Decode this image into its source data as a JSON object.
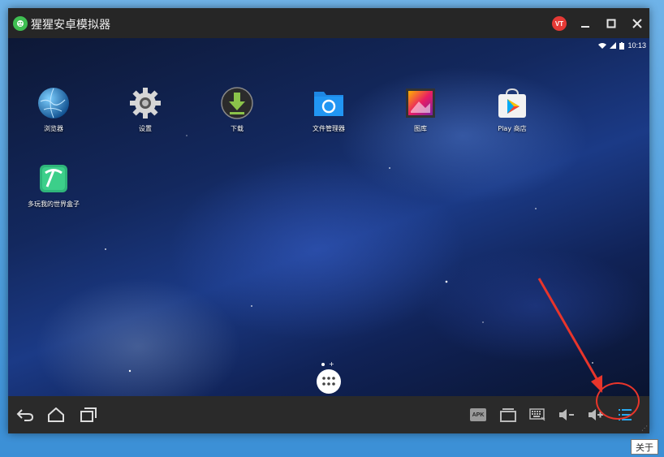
{
  "window": {
    "title": "猩猩安卓模拟器",
    "user_badge": "VT"
  },
  "statusbar": {
    "time": "10:13"
  },
  "apps": [
    {
      "label": "浏览器",
      "icon": "browser-globe-icon"
    },
    {
      "label": "设置",
      "icon": "settings-gear-icon"
    },
    {
      "label": "下载",
      "icon": "download-icon"
    },
    {
      "label": "文件管理器",
      "icon": "file-manager-folder-icon"
    },
    {
      "label": "图库",
      "icon": "gallery-icon"
    },
    {
      "label": "Play 商店",
      "icon": "play-store-icon"
    },
    {
      "label": "多玩我的世界盒子",
      "icon": "minecraft-box-pickaxe-icon"
    }
  ],
  "navbar": {
    "apk_label": "APK",
    "icons": [
      "back-icon",
      "home-icon",
      "recents-icon",
      "apk-install-icon",
      "multi-window-icon",
      "keyboard-icon",
      "volume-down-icon",
      "volume-up-icon",
      "menu-list-icon"
    ]
  },
  "tooltip": {
    "about": "关于"
  },
  "colors": {
    "highlight": "#e8352b",
    "menu_icon": "#29a8f0",
    "app_logo": "#3fbf52",
    "user_badge": "#e53935"
  }
}
